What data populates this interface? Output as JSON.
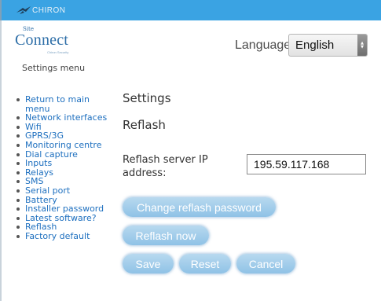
{
  "brand": {
    "name": "CHIRON"
  },
  "logo": {
    "small": "Site",
    "main": "Connect",
    "tagline": "Chiron Security"
  },
  "header": {
    "language_label": "Language:",
    "language_value": "English",
    "menu_title": "Settings menu"
  },
  "sidebar": {
    "items": [
      "Return to main menu",
      "Network interfaces",
      "Wifi",
      "GPRS/3G",
      "Monitoring centre",
      "Dial capture",
      "Inputs",
      "Relays",
      "SMS",
      "Serial port",
      "Battery",
      "Installer password",
      "Latest software?",
      "Reflash",
      "Factory default"
    ]
  },
  "main": {
    "title": "Settings",
    "subtitle": "Reflash",
    "server_label": "Reflash server IP address:",
    "server_value": "195.59.117.168"
  },
  "buttons": {
    "change_password": "Change reflash password",
    "reflash_now": "Reflash now",
    "save": "Save",
    "reset": "Reset",
    "cancel": "Cancel"
  },
  "colors": {
    "topbar": "#3aa3e3",
    "link": "#1d6fbf",
    "button": "#9cc9e9"
  }
}
